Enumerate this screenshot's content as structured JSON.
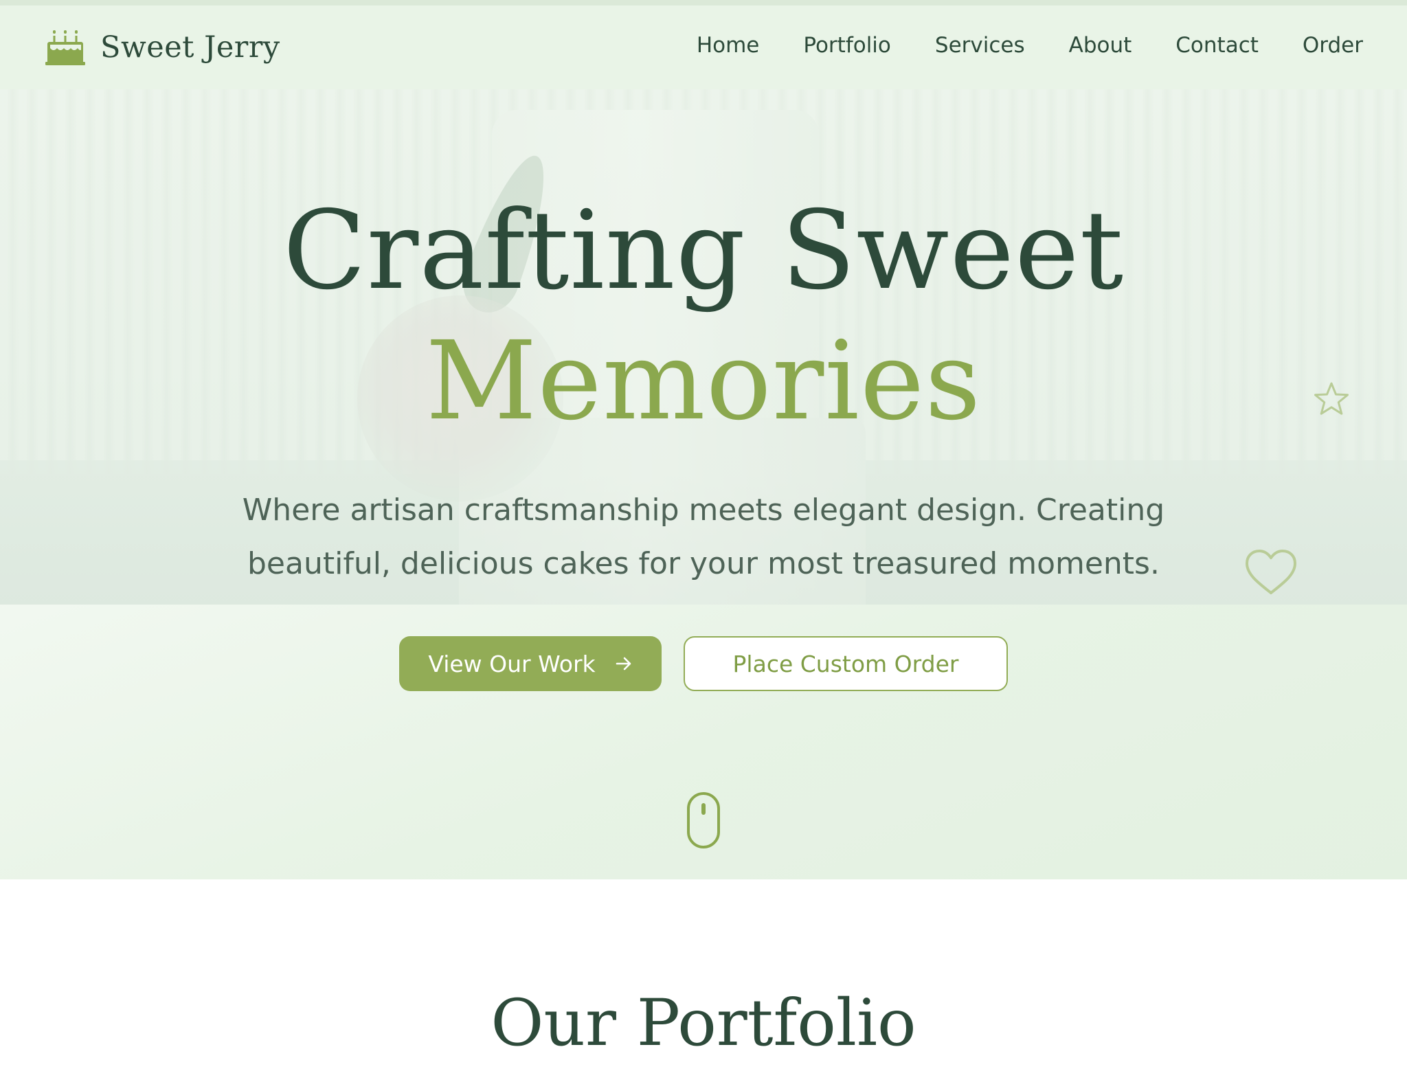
{
  "brand": {
    "name": "Sweet Jerry",
    "icon": "cake-icon"
  },
  "nav": {
    "items": [
      {
        "label": "Home"
      },
      {
        "label": "Portfolio"
      },
      {
        "label": "Services"
      },
      {
        "label": "About"
      },
      {
        "label": "Contact"
      },
      {
        "label": "Order"
      }
    ]
  },
  "hero": {
    "title_line1": "Crafting Sweet",
    "title_line2": "Memories",
    "subtitle": "Where artisan craftsmanship meets elegant design. Creating beautiful, delicious cakes for your most treasured moments.",
    "primary_button": {
      "label": "View Our Work",
      "icon": "arrow-right-icon"
    },
    "secondary_button": {
      "label": "Place Custom Order"
    },
    "decorations": [
      "star-icon",
      "heart-icon"
    ],
    "scroll_indicator": "mouse-icon"
  },
  "portfolio": {
    "title": "Our Portfolio"
  },
  "colors": {
    "dark_green": "#2d4a3a",
    "accent_green": "#92ac56",
    "header_bg": "#e9f4e7",
    "text_muted": "#4e6357"
  }
}
